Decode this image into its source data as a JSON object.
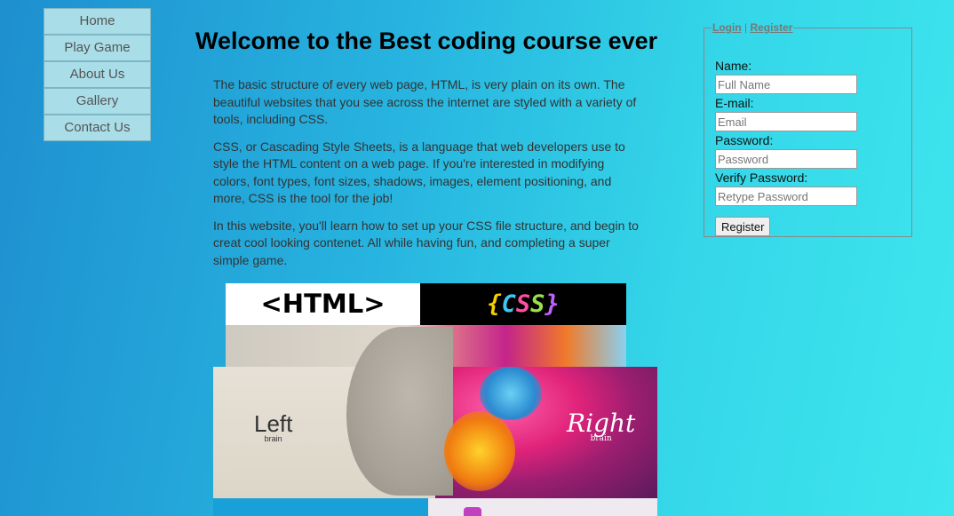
{
  "nav": {
    "items": [
      {
        "label": "Home"
      },
      {
        "label": "Play Game"
      },
      {
        "label": "About Us"
      },
      {
        "label": "Gallery"
      },
      {
        "label": "Contact Us"
      }
    ]
  },
  "main": {
    "title": "Welcome to the Best coding course ever",
    "paragraphs": [
      "The basic structure of every web page, HTML, is very plain on its own. The beautiful websites that you see across the internet are styled with a variety of tools, including CSS.",
      "CSS, or Cascading Style Sheets, is a language that web developers use to style the HTML content on a web page. If you're interested in modifying colors, font types, font sizes, shadows, images, element positioning, and more, CSS is the tool for the job!",
      "In this website, you'll learn how to set up your CSS file structure, and begin to creat cool looking contenet. All while having fun, and completing a super simple game."
    ],
    "image": {
      "html_label": "<HTML>",
      "css_label_open": "{",
      "css_label_c1": "C",
      "css_label_c2": "S",
      "css_label_c3": "S",
      "css_label_close": "}",
      "left_label": "Left",
      "left_sub": "brain",
      "right_label": "Right",
      "right_sub": "brain"
    }
  },
  "auth": {
    "legend_login": "Login",
    "legend_sep": " | ",
    "legend_register": "Register",
    "fields": [
      {
        "label": "Name:",
        "placeholder": "Full Name",
        "value": ""
      },
      {
        "label": "E-mail:",
        "placeholder": "Email",
        "value": ""
      },
      {
        "label": "Password:",
        "placeholder": "Password",
        "value": ""
      },
      {
        "label": "Verify Password:",
        "placeholder": "Retype Password",
        "value": ""
      }
    ],
    "submit_label": "Register"
  },
  "colors": {
    "background_start": "#1e8fcf",
    "background_end": "#3ee6ee",
    "nav_button": "#a9dde8"
  }
}
